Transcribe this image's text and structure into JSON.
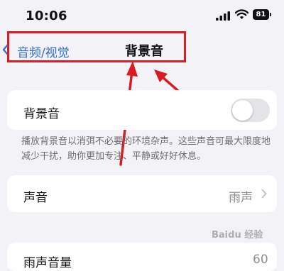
{
  "status_bar": {
    "time": "10:06",
    "battery": "81",
    "icons": [
      "signal-icon",
      "wifi-icon",
      "battery-icon"
    ]
  },
  "nav": {
    "back_label": "音频/视觉",
    "title": "背景音",
    "back_icon": "chevron-left-icon",
    "accent_color": "#2f6fd6"
  },
  "background_sound": {
    "label": "背景音",
    "toggle_on": false,
    "description": "播放背景音以消弭不必要的环境杂声。这些声音可最大限度地减少干扰，助你更加专注、平静或好好休息。"
  },
  "sound": {
    "label": "声音",
    "value": "雨声",
    "chevron_icon": "chevron-right-icon"
  },
  "partial_row": {
    "label": "雨声音量",
    "value": "60"
  },
  "annotation_color": "#d81c22",
  "watermark": "Baidu 经验"
}
